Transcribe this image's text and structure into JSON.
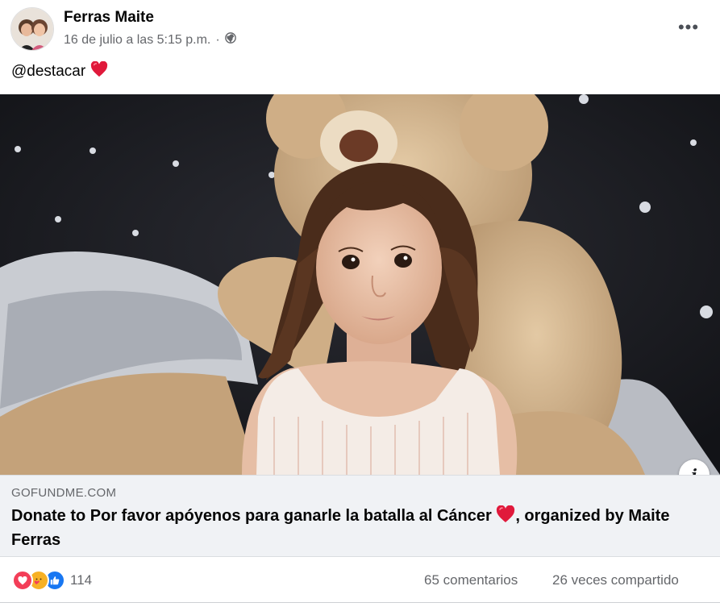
{
  "post": {
    "author": "Ferras Maite",
    "date": "16 de julio a las 5:15 p.m.",
    "separator": "·",
    "privacy_icon": "globe-icon",
    "menu_icon": "more-options-icon",
    "menu_glyph": "•••",
    "caption_text": "@destacar",
    "caption_emoji": "heart-icon"
  },
  "link": {
    "domain": "GOFUNDME.COM",
    "title_part1": "Donate to Por favor apóyenos para ganarle la batalla al Cáncer ",
    "title_part2": ", organized by Maite Ferras",
    "info_glyph": "i"
  },
  "footer": {
    "reaction_icons": [
      "love-icon",
      "care-icon",
      "like-icon"
    ],
    "reaction_count": "114",
    "comments": "65 comentarios",
    "shares": "26 veces compartido"
  },
  "colors": {
    "love": "#f33e58",
    "care": "#f7b125",
    "like": "#1877f2",
    "muted": "#65676b"
  }
}
